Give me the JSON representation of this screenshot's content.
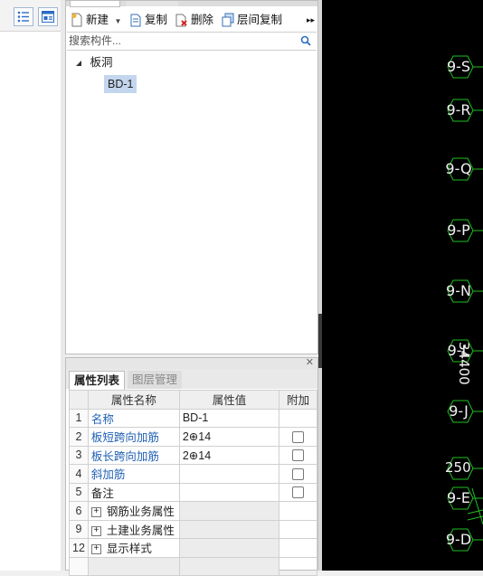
{
  "toolbar": {
    "new_label": "新建",
    "copy_label": "复制",
    "delete_label": "删除",
    "floor_copy_label": "层间复制",
    "more_label": "▸▸"
  },
  "search": {
    "placeholder": "搜索构件..."
  },
  "tree": {
    "root_label": "板洞",
    "child_label": "BD-1"
  },
  "properties": {
    "tabs": [
      "属性列表",
      "图层管理"
    ],
    "columns": [
      "属性名称",
      "属性值",
      "附加"
    ],
    "rows": [
      {
        "num": "1",
        "name": "名称",
        "value": "BD-1"
      },
      {
        "num": "2",
        "name": "板短跨向加筋",
        "value": "2⊕14"
      },
      {
        "num": "3",
        "name": "板长跨向加筋",
        "value": "2⊕14"
      },
      {
        "num": "4",
        "name": "斜加筋",
        "value": ""
      },
      {
        "num": "5",
        "name": "备注",
        "value": ""
      },
      {
        "num": "6",
        "name": "钢筋业务属性",
        "value": ""
      },
      {
        "num": "9",
        "name": "土建业务属性",
        "value": ""
      },
      {
        "num": "12",
        "name": "显示样式",
        "value": ""
      }
    ]
  },
  "canvas": {
    "axes": [
      "9-S",
      "9-R",
      "9-Q",
      "9-P",
      "9-N",
      "9-L",
      "9-J",
      "9-E",
      "9-D"
    ],
    "dim_vertical": "34400",
    "dim_horizontal": "250"
  },
  "colors": {
    "canvas_bg": "#000000",
    "axis_circle": "#1fbf1f",
    "link_blue": "#1f5fb4",
    "selection": "#c3d6ee"
  }
}
